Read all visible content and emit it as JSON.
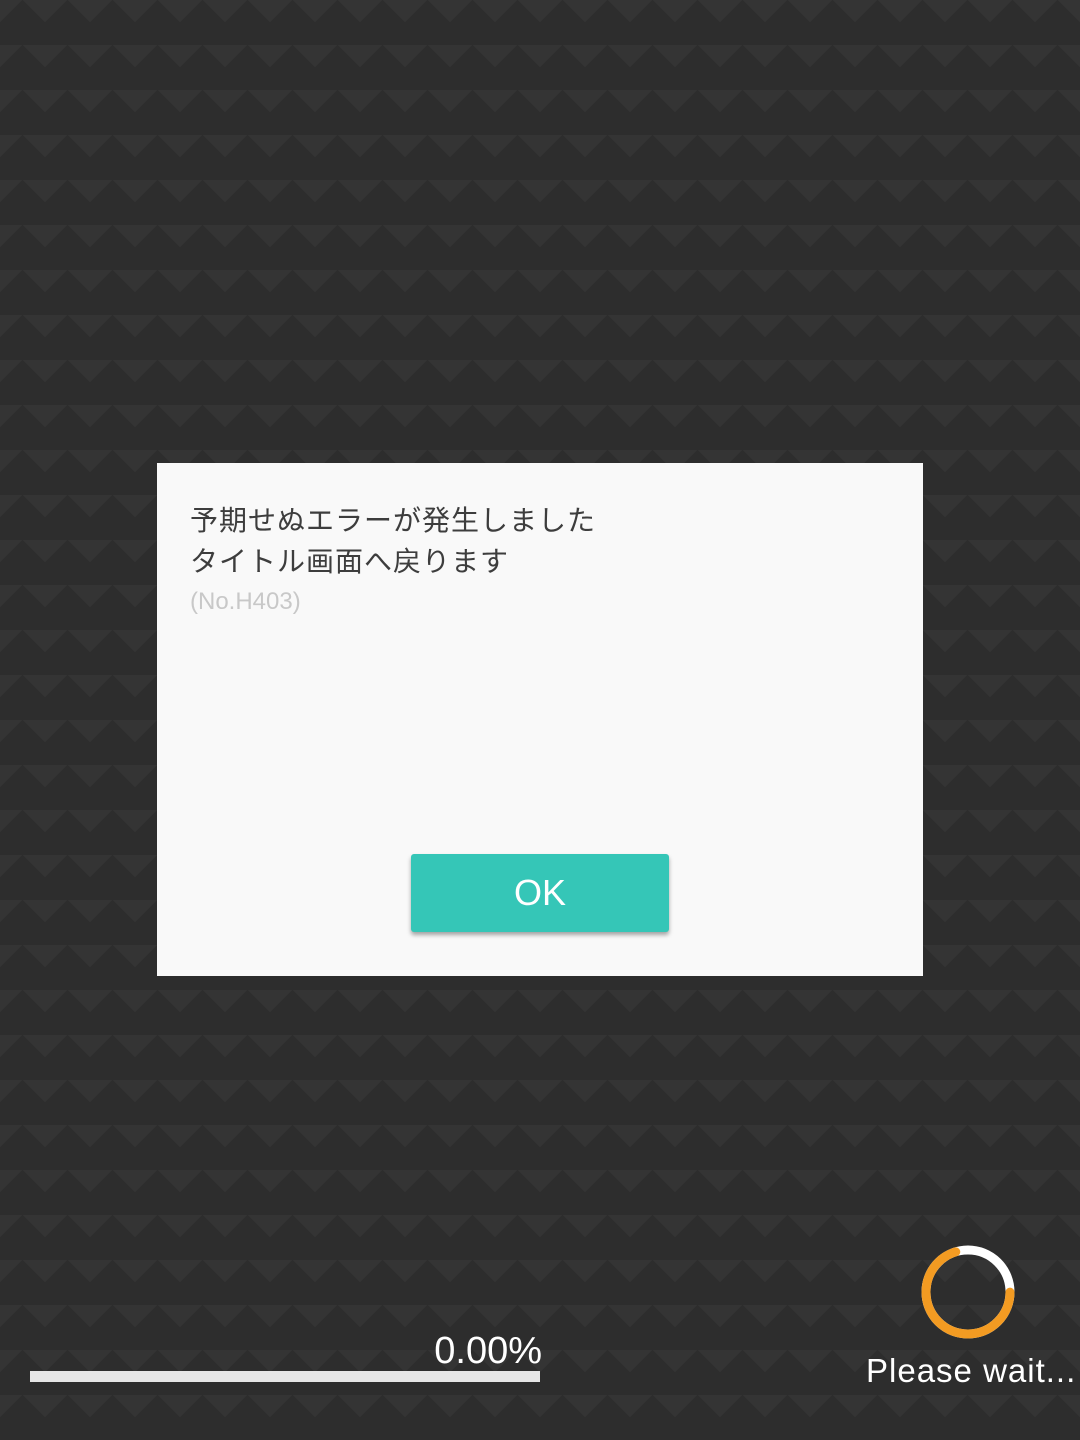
{
  "dialog": {
    "message_line1": "予期せぬエラーが発生しました",
    "message_line2": "タイトル画面へ戻ります",
    "error_code": "(No.H403)",
    "ok_label": "OK"
  },
  "loading": {
    "progress_text": "0.00%",
    "progress_fraction": 0.0,
    "status_text": "Please wait...",
    "spinner_icon": "loading-spinner-icon"
  },
  "colors": {
    "background": "#2d2d2d",
    "dialog_background": "#f9f9f9",
    "ok_button": "#35c6b7",
    "spinner_accent": "#f39b22",
    "progress_track": "#e6e6e6"
  }
}
